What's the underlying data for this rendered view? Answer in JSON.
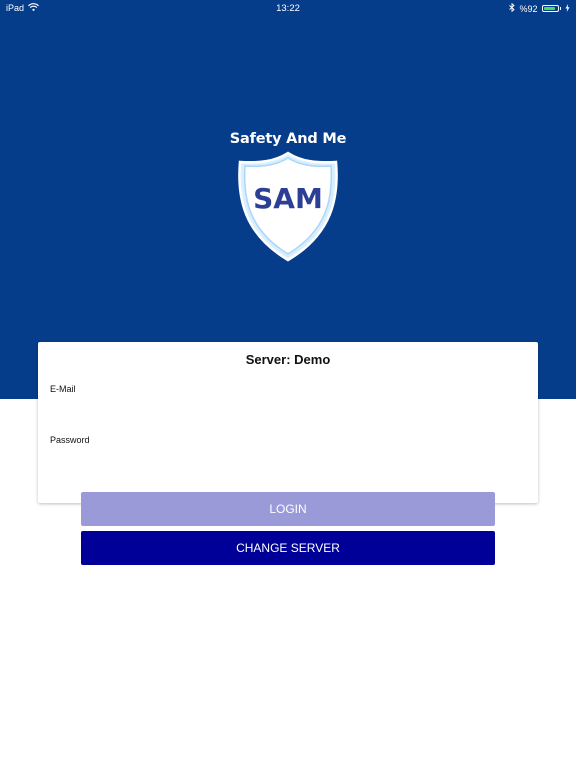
{
  "status_bar": {
    "device": "iPad",
    "time": "13:22",
    "battery": "%92",
    "battery_fraction": 0.92
  },
  "brand": {
    "title": "Safety And Me",
    "logo_text": "SAM"
  },
  "login_card": {
    "server_label": "Server: Demo",
    "email_label": "E-Mail",
    "email_value": "",
    "password_label": "Password",
    "password_value": ""
  },
  "buttons": {
    "login": "LOGIN",
    "change_server": "CHANGE SERVER"
  },
  "colors": {
    "hero_background": "#063d8a",
    "login_button": "#9a9ad8",
    "change_server_button": "#000099",
    "logo_text": "#2b3f96",
    "battery": "#4cd964"
  }
}
